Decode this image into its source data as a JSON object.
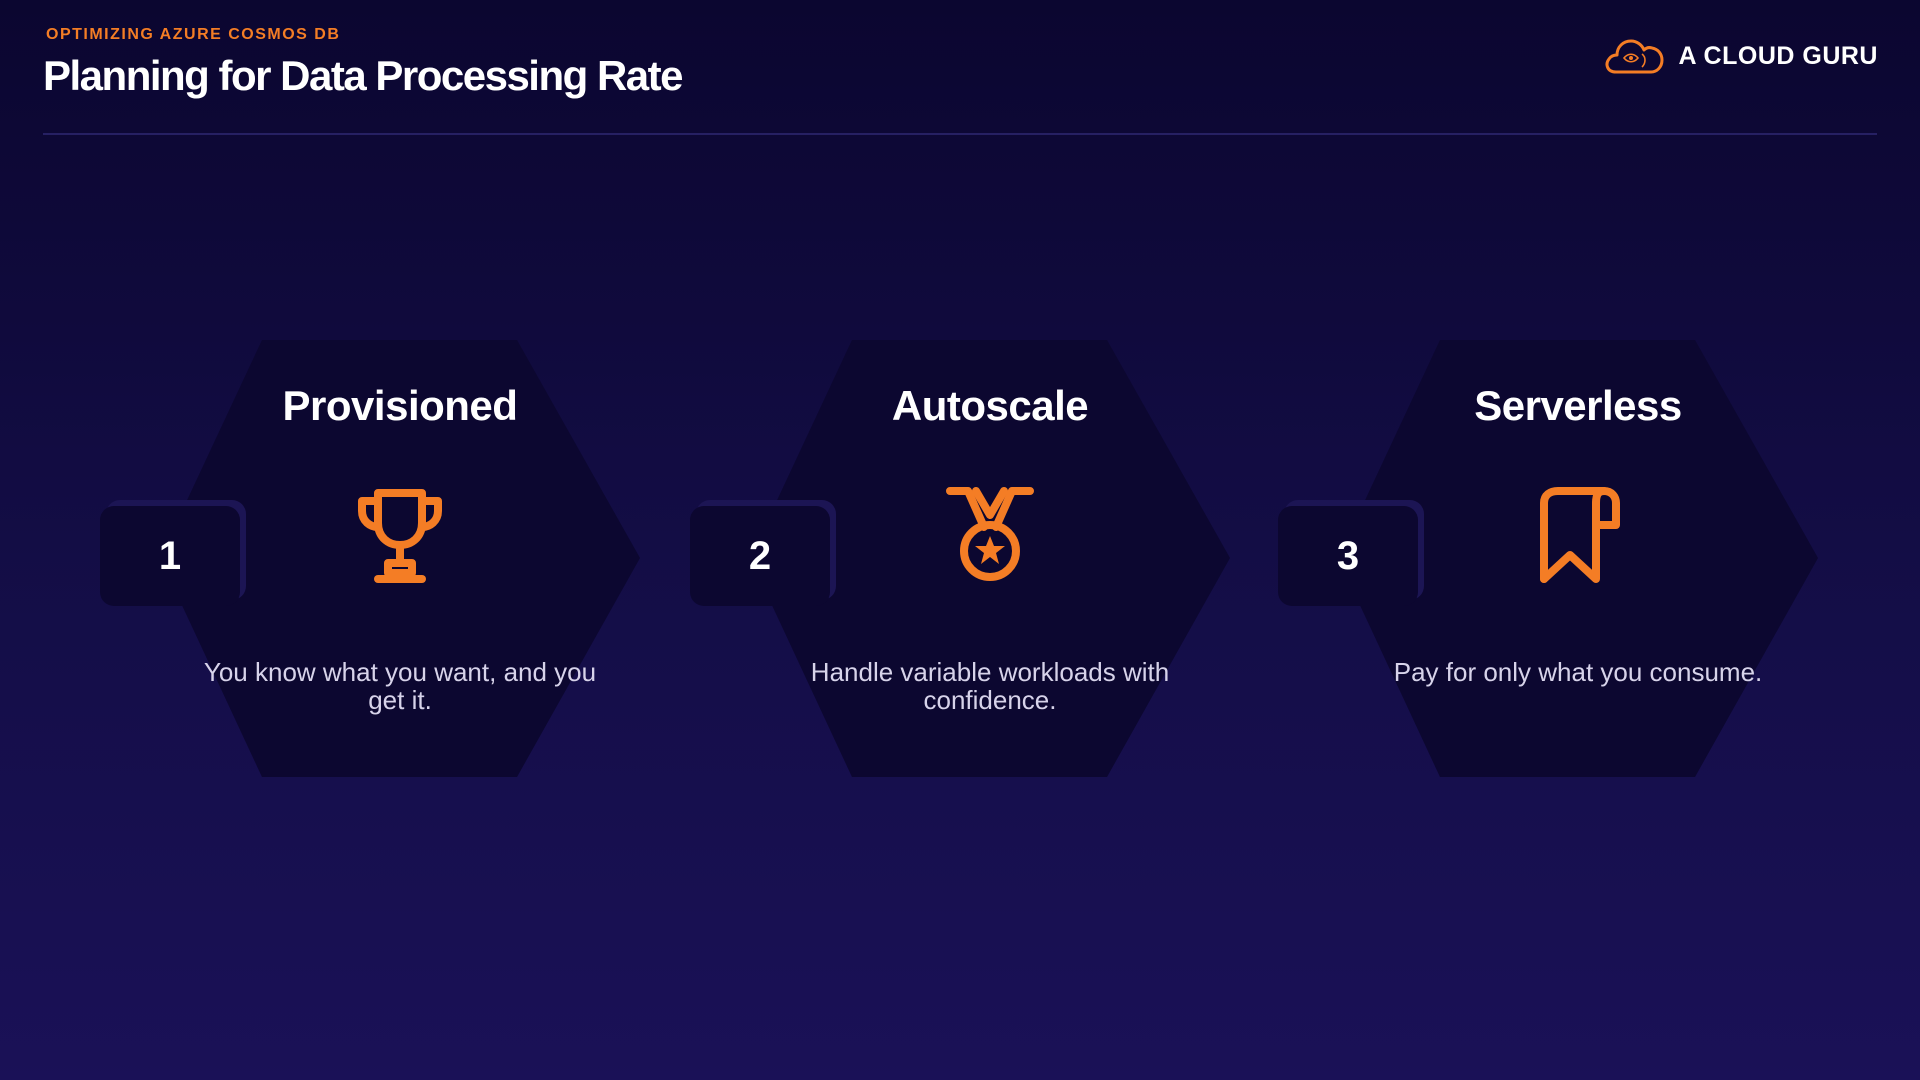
{
  "header": {
    "eyebrow": "OPTIMIZING AZURE COSMOS DB",
    "title": "Planning for Data Processing Rate"
  },
  "brand": {
    "name": "A CLOUD GURU",
    "icon": "cloud-icon"
  },
  "colors": {
    "accent": "#f47d25",
    "background": "#130d45",
    "hexagon": "#0c0730",
    "text": "#ffffff"
  },
  "cards": [
    {
      "number": "1",
      "title": "Provisioned",
      "icon": "trophy-icon",
      "description": "You know what you want, and you get it."
    },
    {
      "number": "2",
      "title": "Autoscale",
      "icon": "medal-icon",
      "description": "Handle variable workloads with confidence."
    },
    {
      "number": "3",
      "title": "Serverless",
      "icon": "bookmark-icon",
      "description": "Pay for only what you consume."
    }
  ]
}
